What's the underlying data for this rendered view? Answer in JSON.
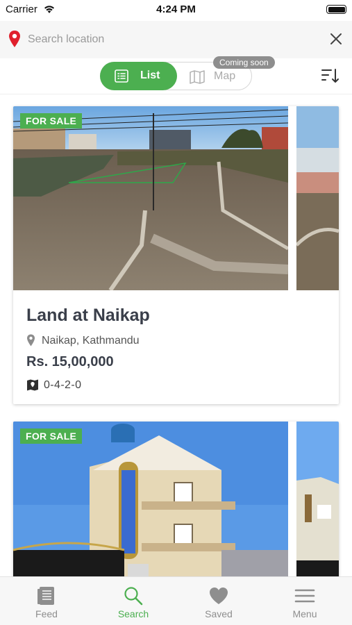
{
  "status_bar": {
    "carrier": "Carrier",
    "time": "4:24 PM"
  },
  "search": {
    "placeholder": "Search location",
    "value": ""
  },
  "view_toggle": {
    "list_label": "List",
    "map_label": "Map",
    "map_badge": "Coming soon",
    "selected": "List"
  },
  "listings": [
    {
      "badge": "FOR SALE",
      "title": "Land at Naikap",
      "location": "Naikap, Kathmandu",
      "price": "Rs. 15,00,000",
      "area": "0-4-2-0"
    },
    {
      "badge": "FOR SALE"
    }
  ],
  "tabs": [
    {
      "label": "Feed",
      "icon": "feed-icon",
      "active": false
    },
    {
      "label": "Search",
      "icon": "search-icon",
      "active": true
    },
    {
      "label": "Saved",
      "icon": "heart-icon",
      "active": false
    },
    {
      "label": "Menu",
      "icon": "hamburger-icon",
      "active": false
    }
  ],
  "colors": {
    "accent": "#4caf50",
    "pin": "#e0202c",
    "inactive": "#8e8e8e"
  }
}
